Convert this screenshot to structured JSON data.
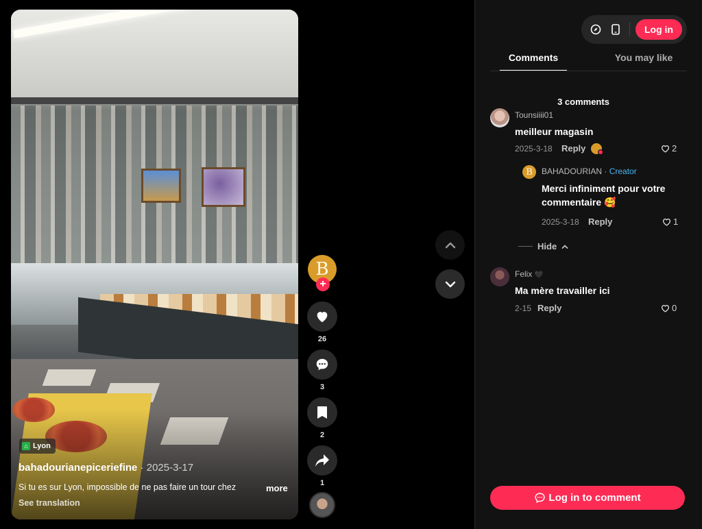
{
  "video": {
    "location": "Lyon",
    "author": "bahadourianepiceriefine",
    "separator": " · ",
    "date": "2025-3-17",
    "caption": "Si tu es sur Lyon, impossible de ne pas faire un tour chez",
    "more_label": "more",
    "see_translation": "See translation"
  },
  "actions": {
    "avatar_letter": "B",
    "follow_plus": "+",
    "likes": "26",
    "comments": "3",
    "saves": "2",
    "shares": "1"
  },
  "header": {
    "login_label": "Log in"
  },
  "tabs": [
    {
      "label": "Comments",
      "active": true
    },
    {
      "label": "You may like",
      "active": false
    }
  ],
  "comments_count": "3 comments",
  "comments": [
    {
      "user": "Tounsiiii01",
      "text": "meilleur magasin",
      "date": "2025-3-18",
      "reply": "Reply",
      "likes": "2"
    },
    {
      "user": "BAHADOURIAN",
      "creator_tag": "· Creator",
      "text": "Merci infiniment pour votre",
      "text2": "commentaire 🥰",
      "date": "2025-3-18",
      "reply": "Reply",
      "likes": "1"
    },
    {
      "user": "Felix",
      "user_badge": "🖤",
      "text": "Ma mère travailler ici",
      "date": "2-15",
      "reply": "Reply",
      "likes": "0"
    }
  ],
  "hide_label": "Hide",
  "bottom_button": "Log in to comment",
  "colors": {
    "accent": "#fe2c55",
    "creator": "#4bb5f0",
    "panel": "#121212"
  }
}
